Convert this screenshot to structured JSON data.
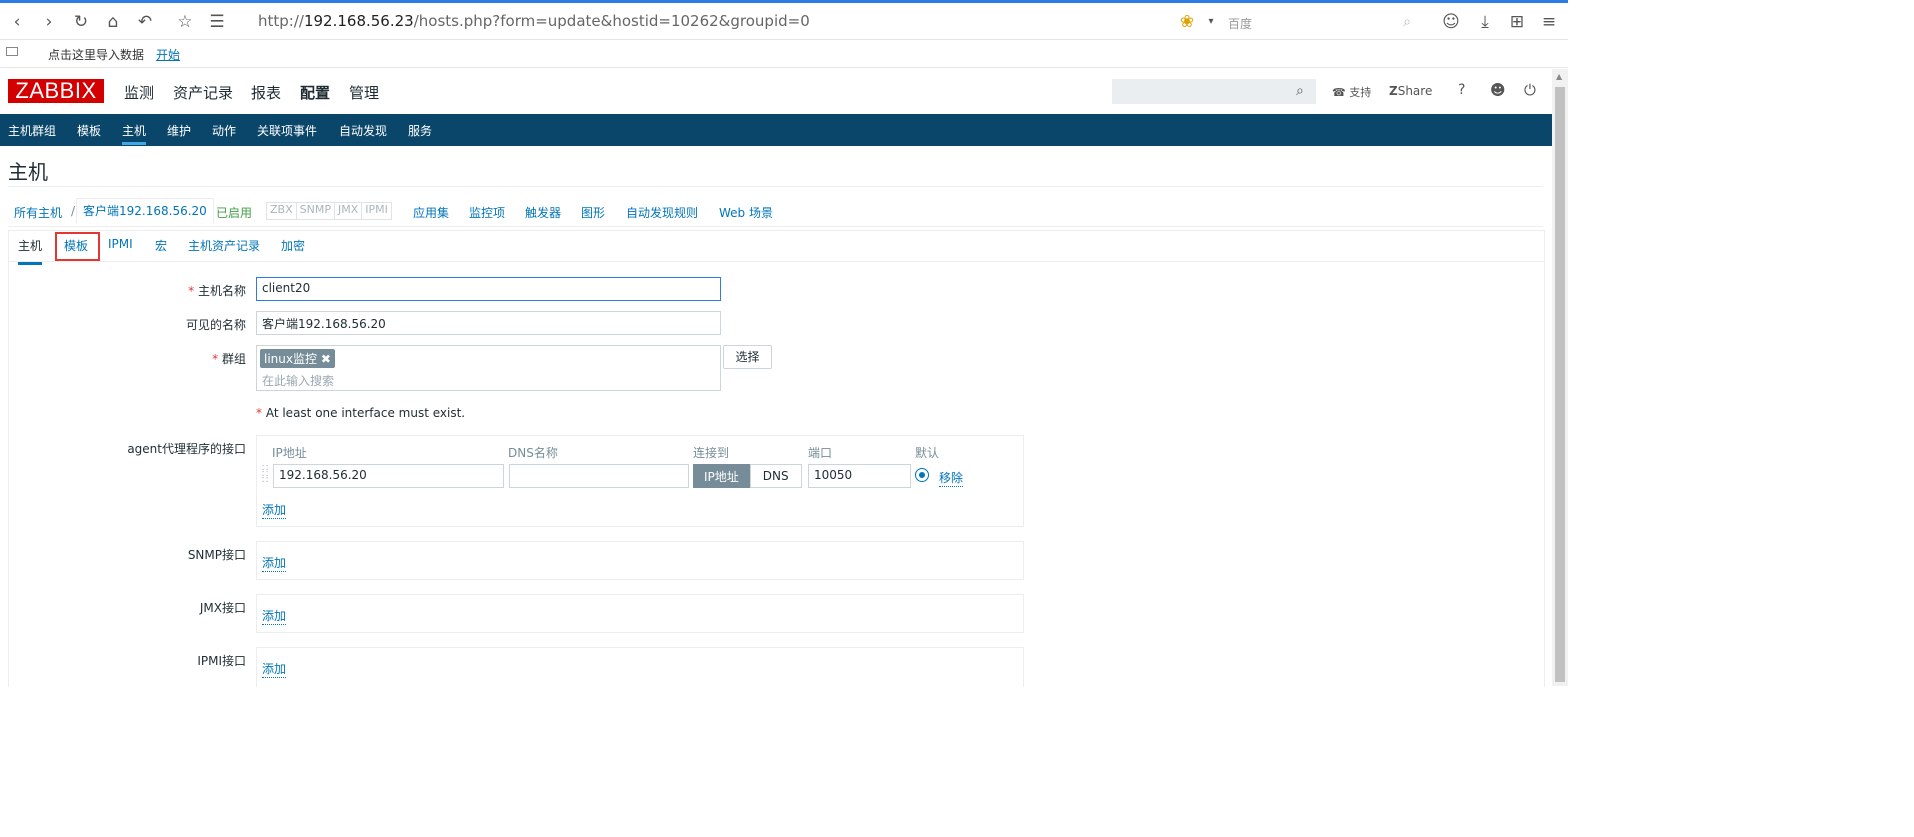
{
  "browser": {
    "url_prefix": "http://",
    "url_host": "192.168.56.23",
    "url_path": "/hosts.php?form=update&hostid=10262&groupid=0",
    "search_placeholder": "百度",
    "bookmark_text": "点击这里导入数据",
    "bookmark_link": "开始"
  },
  "header": {
    "logo": "ZABBIX",
    "menu": [
      "监测",
      "资产记录",
      "报表",
      "配置",
      "管理"
    ],
    "support": "支持",
    "share": "Share",
    "help": "?"
  },
  "subnav": [
    "主机群组",
    "模板",
    "主机",
    "维护",
    "动作",
    "关联项事件",
    "自动发现",
    "服务"
  ],
  "page_title": "主机",
  "breadcrumb": {
    "all_hosts": "所有主机",
    "sep": "/",
    "current_host": "客户端192.168.56.20",
    "status": "已启用",
    "availability": [
      "ZBX",
      "SNMP",
      "JMX",
      "IPMI"
    ],
    "links": [
      "应用集",
      "监控项",
      "触发器",
      "图形",
      "自动发现规则",
      "Web 场景"
    ]
  },
  "tabs": [
    "主机",
    "模板",
    "IPMI",
    "宏",
    "主机资产记录",
    "加密"
  ],
  "form": {
    "host_name_label": "主机名称",
    "host_name_value": "client20",
    "visible_name_label": "可见的名称",
    "visible_name_value": "客户端192.168.56.20",
    "groups_label": "群组",
    "group_tag": "linux监控",
    "groups_placeholder": "在此输入搜索",
    "select_button": "选择",
    "interface_warning": "At least one interface must exist.",
    "agent_label": "agent代理程序的接口",
    "col_ip": "IP地址",
    "col_dns": "DNS名称",
    "col_connect": "连接到",
    "col_port": "端口",
    "col_default": "默认",
    "ip_value": "192.168.56.20",
    "dns_value": "",
    "connect_ip": "IP地址",
    "connect_dns": "DNS",
    "port_value": "10050",
    "remove_link": "移除",
    "add_link": "添加",
    "snmp_label": "SNMP接口",
    "jmx_label": "JMX接口",
    "ipmi_label": "IPMI接口"
  },
  "colors": {
    "brand_red": "#d40000",
    "nav_blue": "#0a466a",
    "link_blue": "#0275b8",
    "enabled_green": "#429e47",
    "highlight_red": "#e33734"
  }
}
